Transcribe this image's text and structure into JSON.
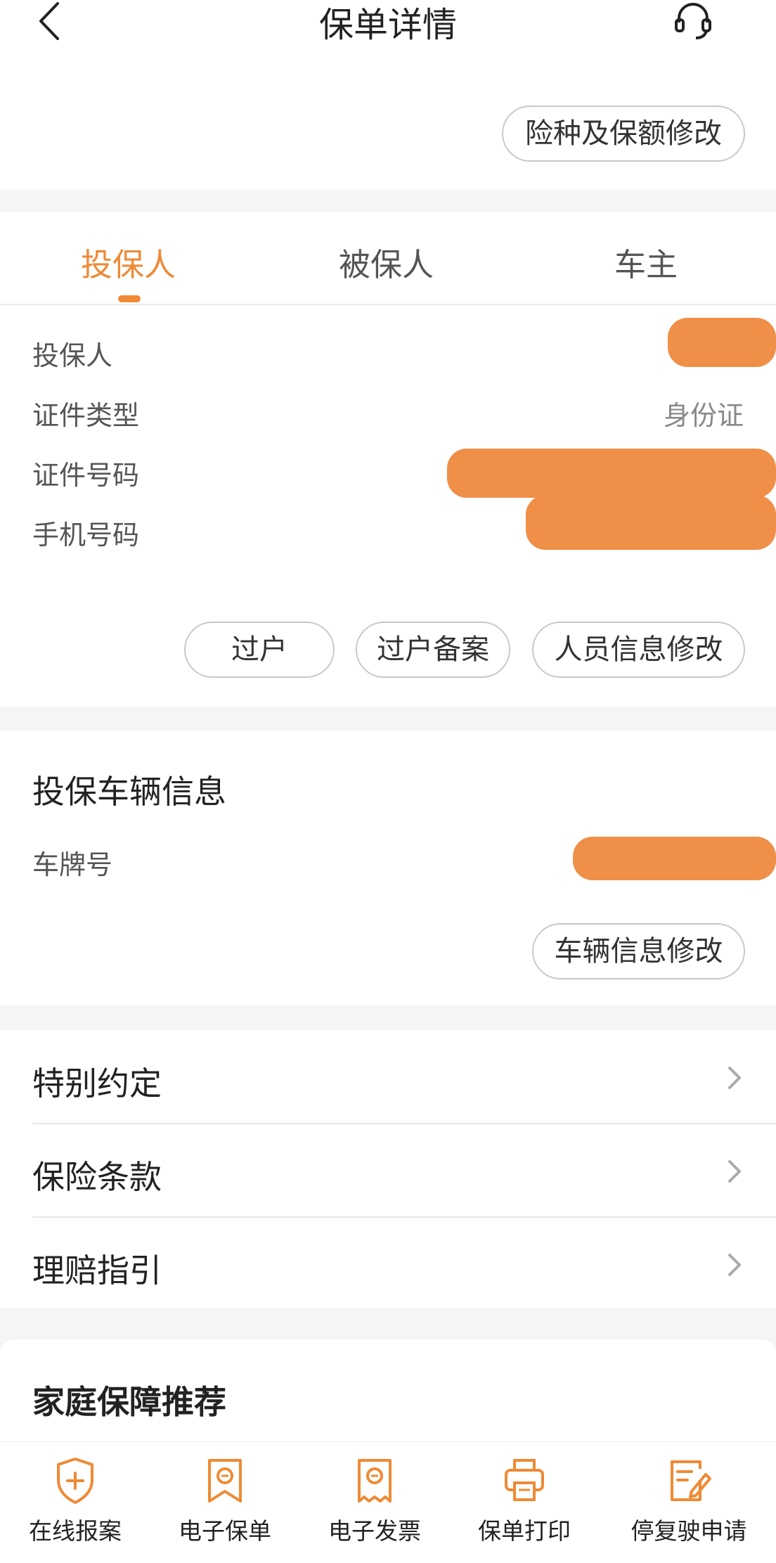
{
  "header": {
    "title": "保单详情"
  },
  "top": {
    "modify_coverage": "险种及保额修改"
  },
  "tabs": [
    {
      "label": "投保人",
      "active": true
    },
    {
      "label": "被保人",
      "active": false
    },
    {
      "label": "车主",
      "active": false
    }
  ],
  "policyholder": {
    "rows": [
      {
        "label": "投保人",
        "value": ""
      },
      {
        "label": "证件类型",
        "value": "身份证"
      },
      {
        "label": "证件号码",
        "value": ""
      },
      {
        "label": "手机号码",
        "value": ""
      }
    ],
    "buttons": {
      "transfer": "过户",
      "transfer_record": "过户备案",
      "modify_person": "人员信息修改"
    }
  },
  "vehicle": {
    "title": "投保车辆信息",
    "plate_label": "车牌号",
    "modify_vehicle": "车辆信息修改"
  },
  "list": [
    {
      "label": "特别约定"
    },
    {
      "label": "保险条款"
    },
    {
      "label": "理赔指引"
    }
  ],
  "recommend": {
    "title": "家庭保障推荐"
  },
  "bottom_nav": [
    {
      "label": "在线报案",
      "icon": "shield-plus-icon"
    },
    {
      "label": "电子保单",
      "icon": "e-policy-icon"
    },
    {
      "label": "电子发票",
      "icon": "e-invoice-icon"
    },
    {
      "label": "保单打印",
      "icon": "printer-icon"
    },
    {
      "label": "停复驶申请",
      "icon": "edit-document-icon"
    }
  ],
  "colors": {
    "accent": "#ef8a35",
    "mask": "#ef8f48",
    "background": "#f5f5f5"
  }
}
